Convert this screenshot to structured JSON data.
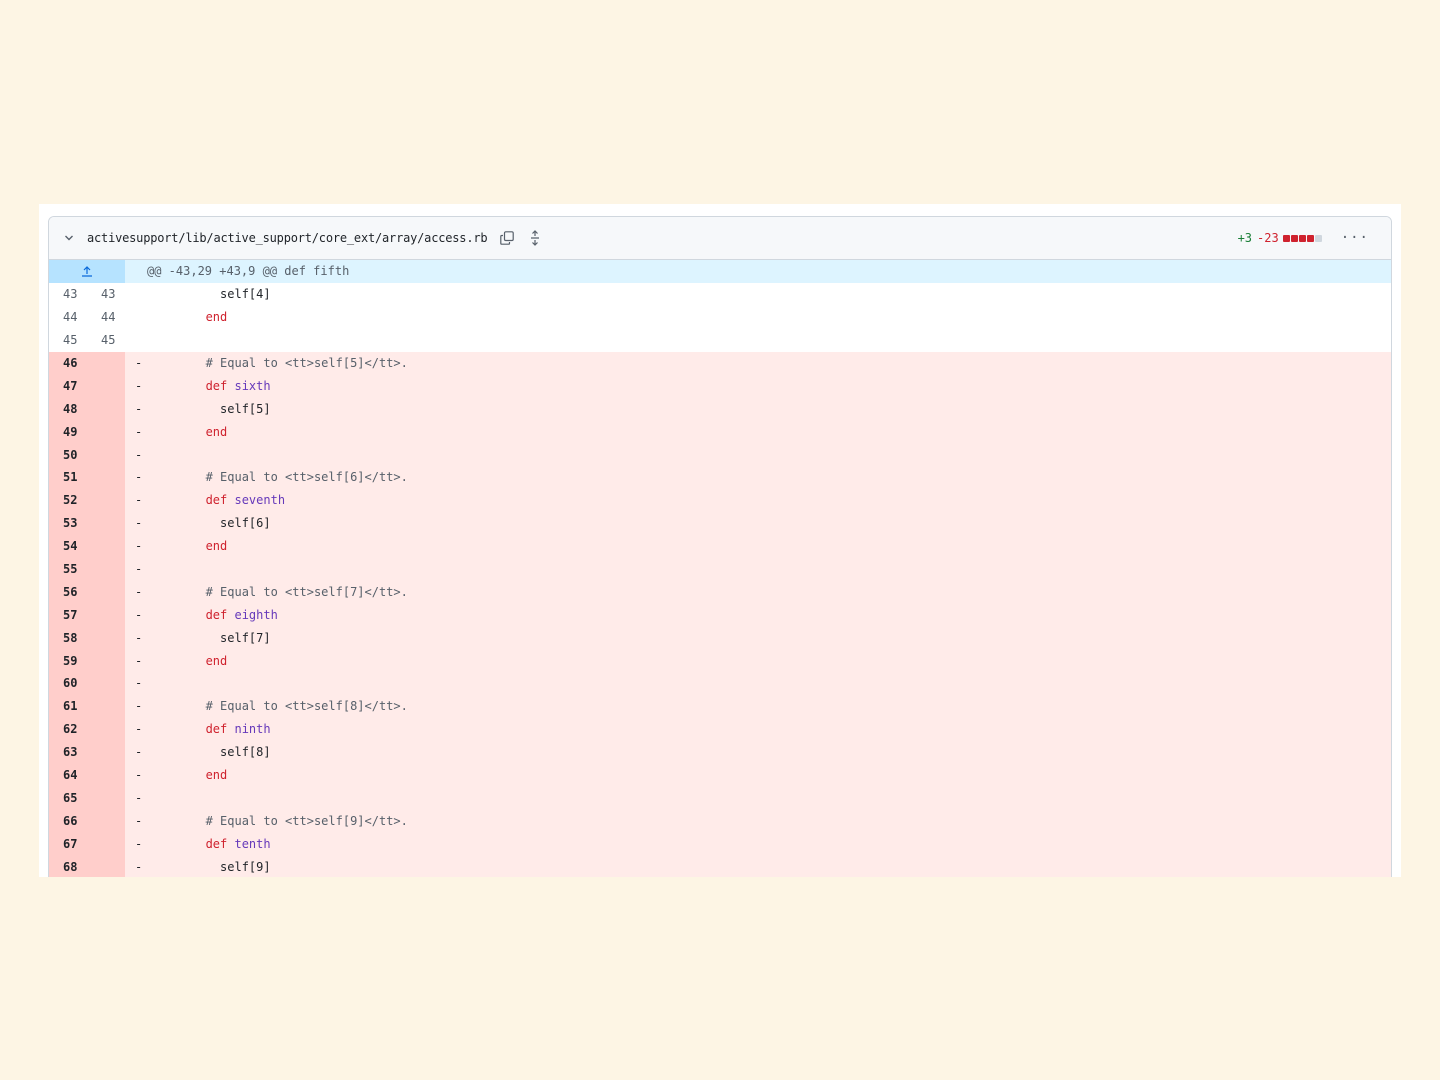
{
  "file": {
    "path": "activesupport/lib/active_support/core_ext/array/access.rb",
    "additions": "+3",
    "deletions": "-23",
    "diffstat": [
      "del",
      "del",
      "del",
      "del",
      "neutral"
    ],
    "icons": {
      "collapse": "chevron-down-icon",
      "copy": "copy-icon",
      "expand": "unfold-icon",
      "more": "kebab-horizontal-icon"
    },
    "more_label": "···"
  },
  "hunk": {
    "header": "@@ -43,29 +43,9 @@ def fifth"
  },
  "lines": [
    {
      "type": "ctx",
      "old": "43",
      "new": "43",
      "indent": "         ",
      "tokens": [
        [
          "tx",
          "self[4]"
        ]
      ]
    },
    {
      "type": "ctx",
      "old": "44",
      "new": "44",
      "indent": "       ",
      "tokens": [
        [
          "kw",
          "end"
        ]
      ]
    },
    {
      "type": "ctx",
      "old": "45",
      "new": "45",
      "indent": "",
      "tokens": []
    },
    {
      "type": "del",
      "old": "46",
      "new": "",
      "indent": "       ",
      "tokens": [
        [
          "cm",
          "# Equal to <tt>self[5]</tt>."
        ]
      ]
    },
    {
      "type": "del",
      "old": "47",
      "new": "",
      "indent": "       ",
      "tokens": [
        [
          "kw",
          "def "
        ],
        [
          "fn",
          "sixth"
        ]
      ]
    },
    {
      "type": "del",
      "old": "48",
      "new": "",
      "indent": "         ",
      "tokens": [
        [
          "tx",
          "self[5]"
        ]
      ]
    },
    {
      "type": "del",
      "old": "49",
      "new": "",
      "indent": "       ",
      "tokens": [
        [
          "kw",
          "end"
        ]
      ]
    },
    {
      "type": "del",
      "old": "50",
      "new": "",
      "indent": "",
      "tokens": []
    },
    {
      "type": "del",
      "old": "51",
      "new": "",
      "indent": "       ",
      "tokens": [
        [
          "cm",
          "# Equal to <tt>self[6]</tt>."
        ]
      ]
    },
    {
      "type": "del",
      "old": "52",
      "new": "",
      "indent": "       ",
      "tokens": [
        [
          "kw",
          "def "
        ],
        [
          "fn",
          "seventh"
        ]
      ]
    },
    {
      "type": "del",
      "old": "53",
      "new": "",
      "indent": "         ",
      "tokens": [
        [
          "tx",
          "self[6]"
        ]
      ]
    },
    {
      "type": "del",
      "old": "54",
      "new": "",
      "indent": "       ",
      "tokens": [
        [
          "kw",
          "end"
        ]
      ]
    },
    {
      "type": "del",
      "old": "55",
      "new": "",
      "indent": "",
      "tokens": []
    },
    {
      "type": "del",
      "old": "56",
      "new": "",
      "indent": "       ",
      "tokens": [
        [
          "cm",
          "# Equal to <tt>self[7]</tt>."
        ]
      ]
    },
    {
      "type": "del",
      "old": "57",
      "new": "",
      "indent": "       ",
      "tokens": [
        [
          "kw",
          "def "
        ],
        [
          "fn",
          "eighth"
        ]
      ]
    },
    {
      "type": "del",
      "old": "58",
      "new": "",
      "indent": "         ",
      "tokens": [
        [
          "tx",
          "self[7]"
        ]
      ]
    },
    {
      "type": "del",
      "old": "59",
      "new": "",
      "indent": "       ",
      "tokens": [
        [
          "kw",
          "end"
        ]
      ]
    },
    {
      "type": "del",
      "old": "60",
      "new": "",
      "indent": "",
      "tokens": []
    },
    {
      "type": "del",
      "old": "61",
      "new": "",
      "indent": "       ",
      "tokens": [
        [
          "cm",
          "# Equal to <tt>self[8]</tt>."
        ]
      ]
    },
    {
      "type": "del",
      "old": "62",
      "new": "",
      "indent": "       ",
      "tokens": [
        [
          "kw",
          "def "
        ],
        [
          "fn",
          "ninth"
        ]
      ]
    },
    {
      "type": "del",
      "old": "63",
      "new": "",
      "indent": "         ",
      "tokens": [
        [
          "tx",
          "self[8]"
        ]
      ]
    },
    {
      "type": "del",
      "old": "64",
      "new": "",
      "indent": "       ",
      "tokens": [
        [
          "kw",
          "end"
        ]
      ]
    },
    {
      "type": "del",
      "old": "65",
      "new": "",
      "indent": "",
      "tokens": []
    },
    {
      "type": "del",
      "old": "66",
      "new": "",
      "indent": "       ",
      "tokens": [
        [
          "cm",
          "# Equal to <tt>self[9]</tt>."
        ]
      ]
    },
    {
      "type": "del",
      "old": "67",
      "new": "",
      "indent": "       ",
      "tokens": [
        [
          "kw",
          "def "
        ],
        [
          "fn",
          "tenth"
        ]
      ]
    },
    {
      "type": "del",
      "old": "68",
      "new": "",
      "indent": "         ",
      "tokens": [
        [
          "tx",
          "self[9]"
        ]
      ]
    }
  ],
  "colors": {
    "page_bg": "#fdf5e4",
    "additions": "#1a7f37",
    "deletions": "#cf222e",
    "del_row_bg": "#ffebe9",
    "del_num_bg": "#ffcecb",
    "hunk_bg": "#ddf4ff",
    "hunk_expander_bg": "#b6e3ff",
    "diffstat_neutral": "#d0d7de"
  }
}
